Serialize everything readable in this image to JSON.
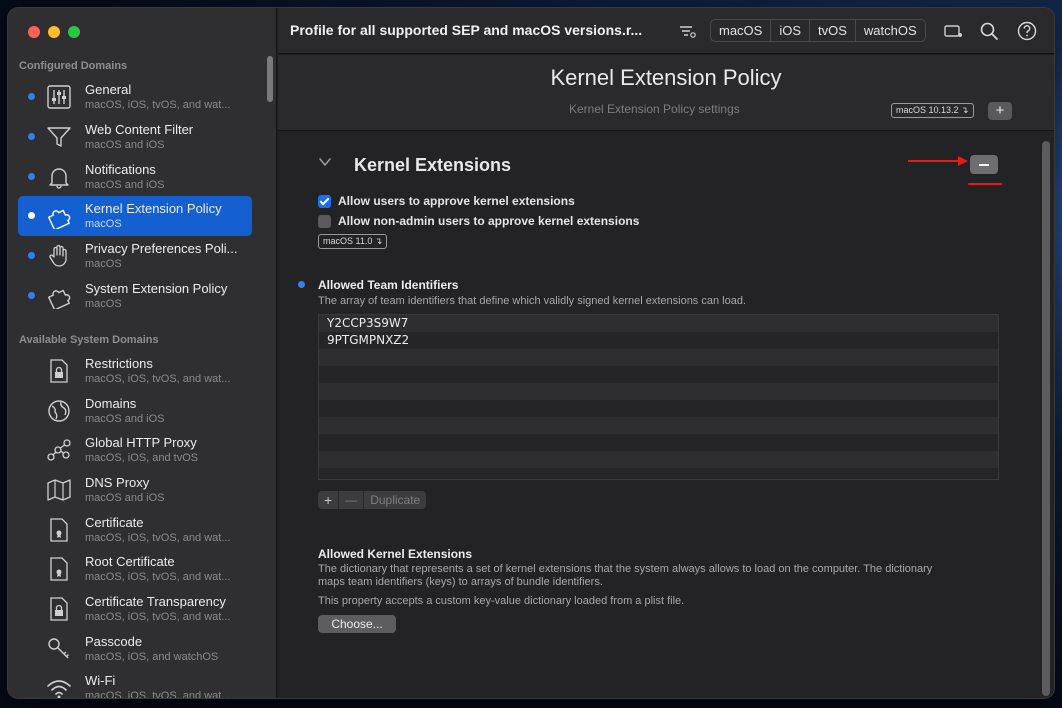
{
  "toolbar": {
    "document_title": "Profile for all supported SEP and macOS versions.r...",
    "platforms": [
      "macOS",
      "iOS",
      "tvOS",
      "watchOS"
    ]
  },
  "sidebar": {
    "configured_title": "Configured Domains",
    "available_title": "Available System Domains",
    "configured": [
      {
        "label": "General",
        "sub": "macOS, iOS, tvOS, and wat...",
        "icon": "sliders-icon"
      },
      {
        "label": "Web Content Filter",
        "sub": "macOS and iOS",
        "icon": "funnel-icon"
      },
      {
        "label": "Notifications",
        "sub": "macOS and iOS",
        "icon": "bell-icon"
      },
      {
        "label": "Kernel Extension Policy",
        "sub": "macOS",
        "icon": "puzzle-icon"
      },
      {
        "label": "Privacy Preferences Poli...",
        "sub": "macOS",
        "icon": "hand-icon"
      },
      {
        "label": "System Extension Policy",
        "sub": "macOS",
        "icon": "puzzle-icon"
      }
    ],
    "available": [
      {
        "label": "Restrictions",
        "sub": "macOS, iOS, tvOS, and wat...",
        "icon": "lock-icon"
      },
      {
        "label": "Domains",
        "sub": "macOS and iOS",
        "icon": "globe-icon"
      },
      {
        "label": "Global HTTP Proxy",
        "sub": "macOS, iOS, and tvOS",
        "icon": "network-icon"
      },
      {
        "label": "DNS Proxy",
        "sub": "macOS and iOS",
        "icon": "map-icon"
      },
      {
        "label": "Certificate",
        "sub": "macOS, iOS, tvOS, and wat...",
        "icon": "certificate-icon"
      },
      {
        "label": "Root Certificate",
        "sub": "macOS, iOS, tvOS, and wat...",
        "icon": "certificate-icon"
      },
      {
        "label": "Certificate Transparency",
        "sub": "macOS, iOS, tvOS, and wat...",
        "icon": "certificate-lock-icon"
      },
      {
        "label": "Passcode",
        "sub": "macOS, iOS, and watchOS",
        "icon": "key-icon"
      },
      {
        "label": "Wi-Fi",
        "sub": "macOS, iOS, tvOS, and wat...",
        "icon": "wifi-icon"
      }
    ]
  },
  "header": {
    "title": "Kernel Extension Policy",
    "subtitle": "Kernel Extension Policy settings",
    "version_badge": "macOS  10.13.2 ↴",
    "add_label": "+"
  },
  "section": {
    "title": "Kernel Extensions",
    "checkbox_allow_users": {
      "label": "Allow users to approve kernel extensions",
      "checked": true
    },
    "checkbox_allow_nonadmin": {
      "label": "Allow non-admin users to approve kernel extensions",
      "checked": false
    },
    "version_badge": "macOS  11.0 ↴"
  },
  "team_ids": {
    "title": "Allowed Team Identifiers",
    "description": "The array of team identifiers that define which validly signed kernel extensions can load.",
    "rows": [
      "Y2CCP3S9W7",
      "9PTGMPNXZ2"
    ],
    "controls": {
      "add": "+",
      "remove": "—",
      "duplicate": "Duplicate"
    }
  },
  "kernel_exts": {
    "title": "Allowed Kernel Extensions",
    "description_line1": "The dictionary that represents a set of kernel extensions that the system always allows to load on the computer. The dictionary",
    "description_line2": "maps team identifiers (keys) to arrays of bundle identifiers.",
    "note": "This property accepts a custom key-value dictionary loaded from a plist file.",
    "choose_label": "Choose..."
  },
  "colors": {
    "accent": "#1560d0",
    "annotation": "#e11d1d"
  }
}
